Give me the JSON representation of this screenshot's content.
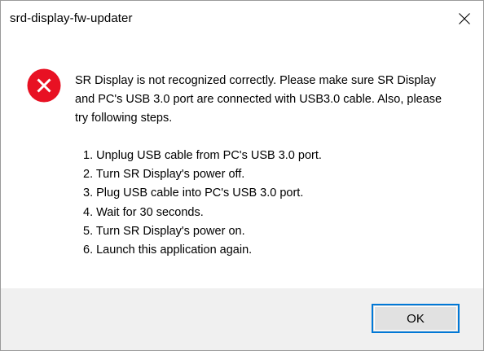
{
  "window": {
    "title": "srd-display-fw-updater"
  },
  "dialog": {
    "icon": "error-icon",
    "message": "SR Display is not recognized correctly. Please make sure SR Display and PC's USB 3.0 port are connected with USB3.0 cable. Also, please try following steps.",
    "steps": [
      "1. Unplug USB cable from PC's USB 3.0 port.",
      "2. Turn SR Display's power off.",
      "3. Plug USB cable into PC's USB 3.0 port.",
      "4. Wait for 30 seconds.",
      "5. Turn SR Display's power on.",
      "6. Launch this application again."
    ],
    "ok_label": "OK"
  },
  "colors": {
    "error_red": "#e81123",
    "focus_blue": "#0078d7",
    "footer_bg": "#f0f0f0"
  }
}
